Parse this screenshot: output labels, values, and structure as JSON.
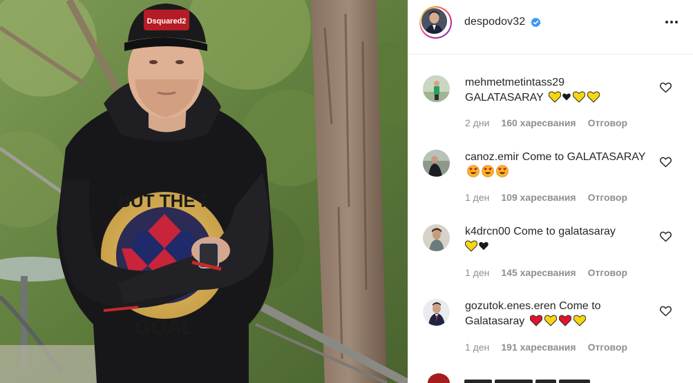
{
  "post": {
    "username": "despodov32",
    "verified": true,
    "more_options_icon": "more-horizontal-icon"
  },
  "photo": {
    "alt_subject": "man in black hoodie and black cap leaning on a railing in a park",
    "cap_text": "Dsquared2",
    "hoodie_text_top": "BUT THE F",
    "hoodie_text_bottom": "GOAL"
  },
  "comments": [
    {
      "user": "mehmetmetintass29",
      "text": "GALATASARAY",
      "emojis": [
        "yellow-heart",
        "black-heart",
        "yellow-heart",
        "yellow-heart"
      ],
      "time": "2 дни",
      "likes": "160 харесвания",
      "reply": "Отговор"
    },
    {
      "user": "canoz.emir",
      "text": "Come to GALATASARAY",
      "emojis": [
        "heart-eyes",
        "heart-eyes",
        "heart-eyes"
      ],
      "time": "1 ден",
      "likes": "109 харесвания",
      "reply": "Отговор"
    },
    {
      "user": "k4drcn00",
      "text": "Come to galatasaray",
      "emojis": [
        "yellow-heart",
        "black-heart"
      ],
      "time": "1 ден",
      "likes": "145 харесвания",
      "reply": "Отговор"
    },
    {
      "user": "gozutok.enes.eren",
      "text": "Come to Galatasaray",
      "emojis": [
        "red-heart",
        "yellow-heart",
        "red-heart",
        "yellow-heart"
      ],
      "time": "1 ден",
      "likes": "191 харесвания",
      "reply": "Отговор"
    }
  ],
  "colors": {
    "text": "#262626",
    "muted": "#8e8e8e",
    "verified_blue": "#3897f0",
    "yellow_heart": "#f7d511",
    "red_heart": "#e0152d"
  }
}
